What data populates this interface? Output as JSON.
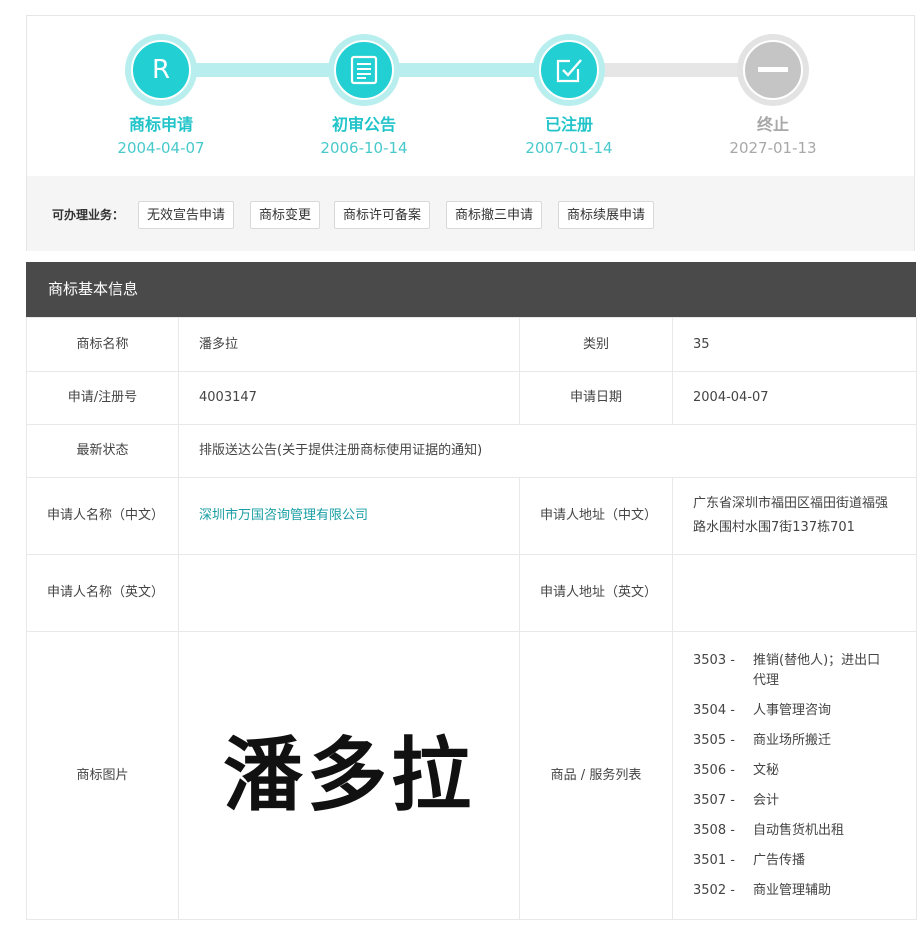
{
  "progress": {
    "steps": [
      {
        "label": "商标申请",
        "date": "2004-04-07",
        "icon": "letter-r-icon",
        "state": "done"
      },
      {
        "label": "初审公告",
        "date": "2006-10-14",
        "icon": "document-icon",
        "state": "done"
      },
      {
        "label": "已注册",
        "date": "2007-01-14",
        "icon": "checkmark-box-icon",
        "state": "done"
      },
      {
        "label": "终止",
        "date": "2027-01-13",
        "icon": "minus-icon",
        "state": "pending"
      }
    ],
    "step_r_glyph": "R"
  },
  "services": {
    "title": "可办理业务：",
    "buttons": [
      "无效宣告申请",
      "商标变更",
      "商标许可备案",
      "商标撤三申请",
      "商标续展申请"
    ]
  },
  "info": {
    "header": "商标基本信息",
    "labels": {
      "name": "商标名称",
      "class": "类别",
      "reg_no": "申请/注册号",
      "app_date": "申请日期",
      "status": "最新状态",
      "applicant_cn": "申请人名称（中文）",
      "address_cn": "申请人地址（中文）",
      "applicant_en": "申请人名称（英文）",
      "address_en": "申请人地址（英文）",
      "image": "商标图片",
      "goods": "商品 / 服务列表"
    },
    "values": {
      "name": "潘多拉",
      "class": "35",
      "reg_no": "4003147",
      "app_date": "2004-04-07",
      "status": "排版送达公告(关于提供注册商标使用证据的通知)",
      "applicant_cn": "深圳市万国咨询管理有限公司",
      "address_cn": "广东省深圳市福田区福田街道福强路水围村水围7街137栋701",
      "applicant_en": "",
      "address_en": "",
      "image_text": "潘多拉"
    },
    "goods": [
      {
        "code": "3503 -",
        "name": "推销(替他人)；进出口代理"
      },
      {
        "code": "3504 -",
        "name": "人事管理咨询"
      },
      {
        "code": "3505 -",
        "name": "商业场所搬迁"
      },
      {
        "code": "3506 -",
        "name": "文秘"
      },
      {
        "code": "3507 -",
        "name": "会计"
      },
      {
        "code": "3508 -",
        "name": "自动售货机出租"
      },
      {
        "code": "3501 -",
        "name": "广告传播"
      },
      {
        "code": "3502 -",
        "name": "商业管理辅助"
      }
    ]
  },
  "colors": {
    "accent": "#22cfd2",
    "accent_light": "#b9eeee",
    "pending": "#c5c5c5",
    "header_bg": "#4a4a4a",
    "link": "#1a9ea5"
  }
}
